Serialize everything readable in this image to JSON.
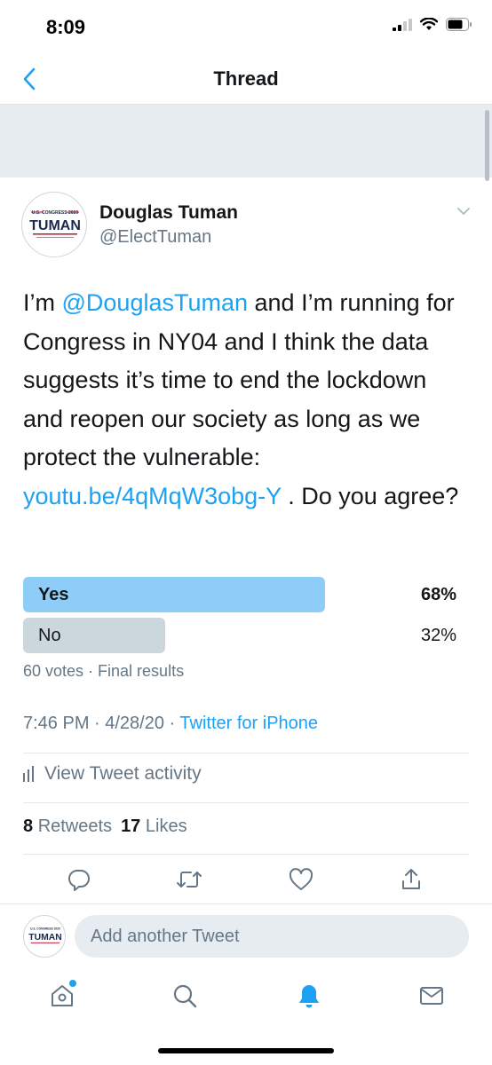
{
  "status_bar": {
    "time": "8:09"
  },
  "nav": {
    "title": "Thread"
  },
  "tweet": {
    "author": {
      "name": "Douglas Tuman",
      "handle": "@ElectTuman",
      "logo_top": "U.S. CONGRESS 2020",
      "logo_main": "TUMAN"
    },
    "text": {
      "part1": "I’m ",
      "mention": "@DouglasTuman",
      "part2": " and I’m running for Congress in NY04 and I think the data suggests it’s time to end the lockdown and reopen our society as long as we protect the vulnerable: ",
      "link": "youtu.be/4qMqW3obg-Y",
      "part3": " . Do you agree?"
    },
    "poll": {
      "options": [
        {
          "label": "Yes",
          "percent": "68%",
          "fraction": 0.68
        },
        {
          "label": "No",
          "percent": "32%",
          "fraction": 0.32
        }
      ],
      "meta": "60 votes · Final results"
    },
    "timestamp": "7:46 PM · 4/28/20 · ",
    "source": "Twitter for iPhone",
    "activity_label": "View Tweet activity",
    "stats": {
      "retweets_count": "8",
      "retweets_label": "Retweets",
      "likes_count": "17",
      "likes_label": "Likes"
    }
  },
  "reply": {
    "placeholder": "Add another Tweet"
  },
  "colors": {
    "accent": "#1da1f2",
    "poll_winner": "#8ecdf8",
    "poll_loser": "#ccd6dd",
    "secondary_text": "#657786"
  },
  "icons": [
    "back-chevron-icon",
    "caret-down-icon",
    "bar-chart-icon",
    "reply-icon",
    "retweet-icon",
    "like-icon",
    "share-icon",
    "home-icon",
    "search-icon",
    "notifications-icon",
    "messages-icon"
  ]
}
